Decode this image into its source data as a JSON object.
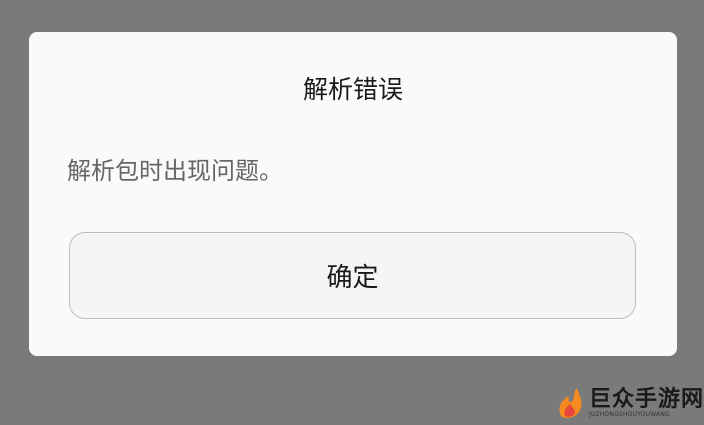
{
  "dialog": {
    "title": "解析错误",
    "message": "解析包时出现问题。",
    "ok_label": "确定"
  },
  "watermark": {
    "title": "巨众手游网",
    "subtitle": "JUZHONGSHOUYOUWANG",
    "icon": "flame-logo-icon"
  },
  "colors": {
    "backdrop": "#7a7a7a",
    "dialog_bg": "#fafafa",
    "button_bg": "#f5f5f5",
    "button_border": "#bdbdbd",
    "logo_orange": "#f58a1f",
    "logo_red": "#e8453c"
  }
}
